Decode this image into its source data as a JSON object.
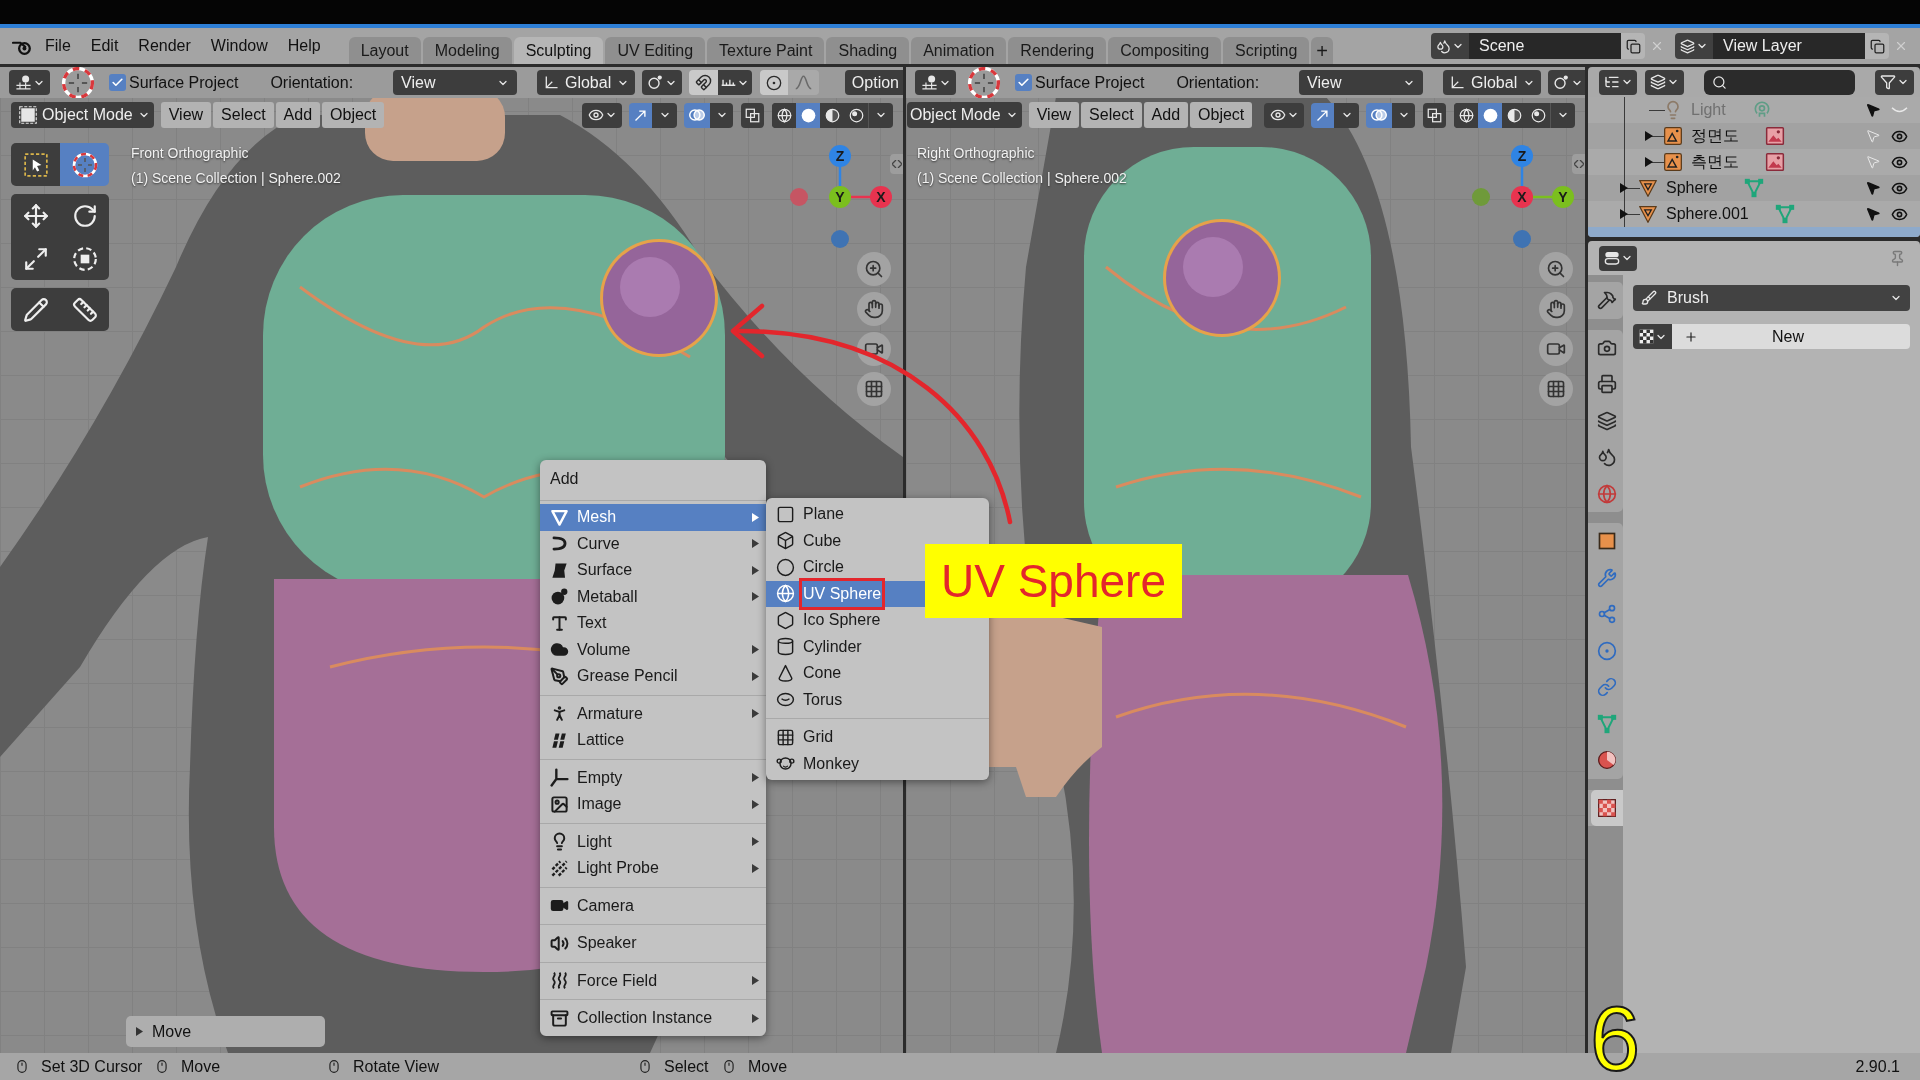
{
  "topbar": {
    "menus": [
      "File",
      "Edit",
      "Render",
      "Window",
      "Help"
    ],
    "workspaces": [
      {
        "label": "Layout",
        "selected": false
      },
      {
        "label": "Modeling",
        "selected": false
      },
      {
        "label": "Sculpting",
        "selected": true
      },
      {
        "label": "UV Editing",
        "selected": false
      },
      {
        "label": "Texture Paint",
        "selected": false
      },
      {
        "label": "Shading",
        "selected": false
      },
      {
        "label": "Animation",
        "selected": false
      },
      {
        "label": "Rendering",
        "selected": false
      },
      {
        "label": "Compositing",
        "selected": false
      },
      {
        "label": "Scripting",
        "selected": false
      }
    ],
    "add_workspace": "+",
    "scene": "Scene",
    "view_layer": "View Layer"
  },
  "viewports": [
    {
      "header": {
        "surface_project": {
          "label": "Surface Project",
          "checked": true
        },
        "orientation_label": "Orientation:",
        "orientation": "View",
        "transform": "Global",
        "tool_icons": [
          {
            "kind": "pivot"
          },
          {
            "kind": "snap"
          },
          {
            "kind": "snap_element"
          },
          {
            "kind": "proportional"
          },
          {
            "kind": "falloff"
          }
        ],
        "options": "Option",
        "mode": "Object Mode",
        "mode_icon": true,
        "menus": [
          "View",
          "Select",
          "Add",
          "Object"
        ],
        "gizmos": true,
        "overlays": true,
        "xray": false,
        "shading": [
          {
            "kind": "wireframe",
            "selected": false
          },
          {
            "kind": "solid",
            "selected": true
          },
          {
            "kind": "material",
            "selected": false
          },
          {
            "kind": "rendered",
            "selected": false
          }
        ]
      },
      "view_name": "Front Orthographic",
      "collection": "(1) Scene Collection | Sphere.002",
      "gizmo": [
        {
          "label": "Z",
          "color": "#2f84e4"
        },
        {
          "label": "Y",
          "color": "#7bbf1e"
        },
        {
          "label": "X",
          "color": "#e8334f"
        }
      ],
      "negative_axes": [
        {
          "color": "#c65563"
        },
        {
          "color": "#3f73b3"
        }
      ],
      "tools": [
        [
          {
            "kind": "select_box",
            "selected": false
          },
          {
            "kind": "cursor",
            "selected": true
          }
        ],
        [
          {
            "kind": "move",
            "selected": false
          },
          {
            "kind": "rotate",
            "selected": false
          },
          {
            "kind": "scale",
            "selected": false
          },
          {
            "kind": "transform",
            "selected": false
          }
        ],
        [
          {
            "kind": "annotate",
            "selected": false
          },
          {
            "kind": "measure",
            "selected": false
          }
        ]
      ],
      "last_operator": {
        "label": "Move",
        "expanded": false
      }
    },
    {
      "header": {
        "surface_project": {
          "label": "Surface Project",
          "checked": true
        },
        "orientation_label": "Orientation:",
        "orientation": "View",
        "transform": "Global",
        "tool_icons": [
          {
            "kind": "pivot"
          }
        ],
        "mode": "Object Mode",
        "mode_icon": false,
        "menus": [
          "View",
          "Select",
          "Add",
          "Object"
        ],
        "gizmos": true,
        "overlays": true,
        "xray": false,
        "shading": [
          {
            "kind": "wireframe",
            "selected": false
          },
          {
            "kind": "solid",
            "selected": true
          },
          {
            "kind": "material",
            "selected": false
          },
          {
            "kind": "rendered",
            "selected": false
          }
        ]
      },
      "view_name": "Right Orthographic",
      "collection": "(1) Scene Collection | Sphere.002",
      "gizmo": [
        {
          "label": "Z",
          "color": "#2f84e4"
        },
        {
          "label": "X",
          "color": "#e8334f"
        },
        {
          "label": "Y",
          "color": "#7bbf1e"
        }
      ],
      "negative_axes": [
        {
          "color": "#6f9a3a"
        },
        {
          "color": "#3f73b3"
        }
      ]
    }
  ],
  "add_menu": {
    "title": "Add",
    "groups": [
      [
        {
          "label": "Mesh",
          "kind": "mesh",
          "submenu": true,
          "selected": true
        },
        {
          "label": "Curve",
          "kind": "curve",
          "submenu": true,
          "selected": false
        },
        {
          "label": "Surface",
          "kind": "surface",
          "submenu": true,
          "selected": false
        },
        {
          "label": "Metaball",
          "kind": "metaball",
          "submenu": true,
          "selected": false
        },
        {
          "label": "Text",
          "kind": "text",
          "submenu": false,
          "selected": false
        },
        {
          "label": "Volume",
          "kind": "volume",
          "submenu": true,
          "selected": false
        },
        {
          "label": "Grease Pencil",
          "kind": "greasepencil",
          "submenu": true,
          "selected": false
        }
      ],
      [
        {
          "label": "Armature",
          "kind": "armature",
          "submenu": true,
          "selected": false
        },
        {
          "label": "Lattice",
          "kind": "lattice",
          "submenu": false,
          "selected": false
        }
      ],
      [
        {
          "label": "Empty",
          "kind": "empty",
          "submenu": true,
          "selected": false
        },
        {
          "label": "Image",
          "kind": "image",
          "submenu": true,
          "selected": false
        }
      ],
      [
        {
          "label": "Light",
          "kind": "light",
          "submenu": true,
          "selected": false
        },
        {
          "label": "Light Probe",
          "kind": "lightprobe",
          "submenu": true,
          "selected": false
        }
      ],
      [
        {
          "label": "Camera",
          "kind": "camera",
          "submenu": false,
          "selected": false
        }
      ],
      [
        {
          "label": "Speaker",
          "kind": "speaker",
          "submenu": false,
          "selected": false
        }
      ],
      [
        {
          "label": "Force Field",
          "kind": "forcefield",
          "submenu": true,
          "selected": false
        }
      ],
      [
        {
          "label": "Collection Instance",
          "kind": "collection",
          "submenu": true,
          "selected": false
        }
      ]
    ],
    "submenu": {
      "groups": [
        [
          {
            "label": "Plane",
            "kind": "plane",
            "selected": false,
            "framed": false
          },
          {
            "label": "Cube",
            "kind": "cube",
            "selected": false,
            "framed": false
          },
          {
            "label": "Circle",
            "kind": "circle",
            "selected": false,
            "framed": false
          },
          {
            "label": "UV Sphere",
            "kind": "uvsphere",
            "selected": true,
            "framed": true
          },
          {
            "label": "Ico Sphere",
            "kind": "icosphere",
            "selected": false,
            "framed": false
          },
          {
            "label": "Cylinder",
            "kind": "cylinder",
            "selected": false,
            "framed": false
          },
          {
            "label": "Cone",
            "kind": "cone",
            "selected": false,
            "framed": false
          },
          {
            "label": "Torus",
            "kind": "torus",
            "selected": false,
            "framed": false
          }
        ],
        [
          {
            "label": "Grid",
            "kind": "grid",
            "selected": false,
            "framed": false
          },
          {
            "label": "Monkey",
            "kind": "monkey",
            "selected": false,
            "framed": false
          }
        ]
      ]
    }
  },
  "annotations": {
    "callout": "UV Sphere",
    "step": "6"
  },
  "outliner": {
    "tree": [
      {
        "children": [
          {
            "label": "Light",
            "kind": "light",
            "expandable": false,
            "disabled": true,
            "selectable": true,
            "visible": false
          },
          {
            "label": "정면도",
            "kind": "image",
            "expandable": true,
            "disabled": false,
            "selectable": false,
            "visible": true
          },
          {
            "label": "측면도",
            "kind": "image",
            "expandable": true,
            "disabled": false,
            "selectable": false,
            "visible": true
          }
        ]
      },
      {
        "label": "Sphere",
        "kind": "mesh",
        "expandable": true,
        "disabled": false,
        "selectable": true,
        "visible": true
      },
      {
        "label": "Sphere.001",
        "kind": "mesh",
        "expandable": true,
        "disabled": false,
        "selectable": true,
        "visible": true
      }
    ]
  },
  "properties": {
    "tab_groups": [
      [
        {
          "kind": "tool",
          "selected": false
        }
      ],
      [
        {
          "kind": "render",
          "selected": false
        },
        {
          "kind": "output",
          "selected": false
        },
        {
          "kind": "viewlayer",
          "selected": false
        },
        {
          "kind": "scene",
          "selected": false
        },
        {
          "kind": "world",
          "selected": false
        }
      ],
      [
        {
          "kind": "object",
          "selected": false
        },
        {
          "kind": "modifiers",
          "selected": false
        },
        {
          "kind": "particles",
          "selected": false
        },
        {
          "kind": "physics",
          "selected": false
        },
        {
          "kind": "constraints",
          "selected": false
        },
        {
          "kind": "data",
          "selected": false
        },
        {
          "kind": "material",
          "selected": false
        }
      ],
      [
        {
          "kind": "texture",
          "selected": true
        }
      ]
    ],
    "brush": "Brush",
    "texture_button": "New"
  },
  "status_bar": {
    "items": [
      "Set 3D Cursor",
      "Move",
      "Rotate View",
      "Select",
      "Move"
    ],
    "version": "2.90.1"
  }
}
